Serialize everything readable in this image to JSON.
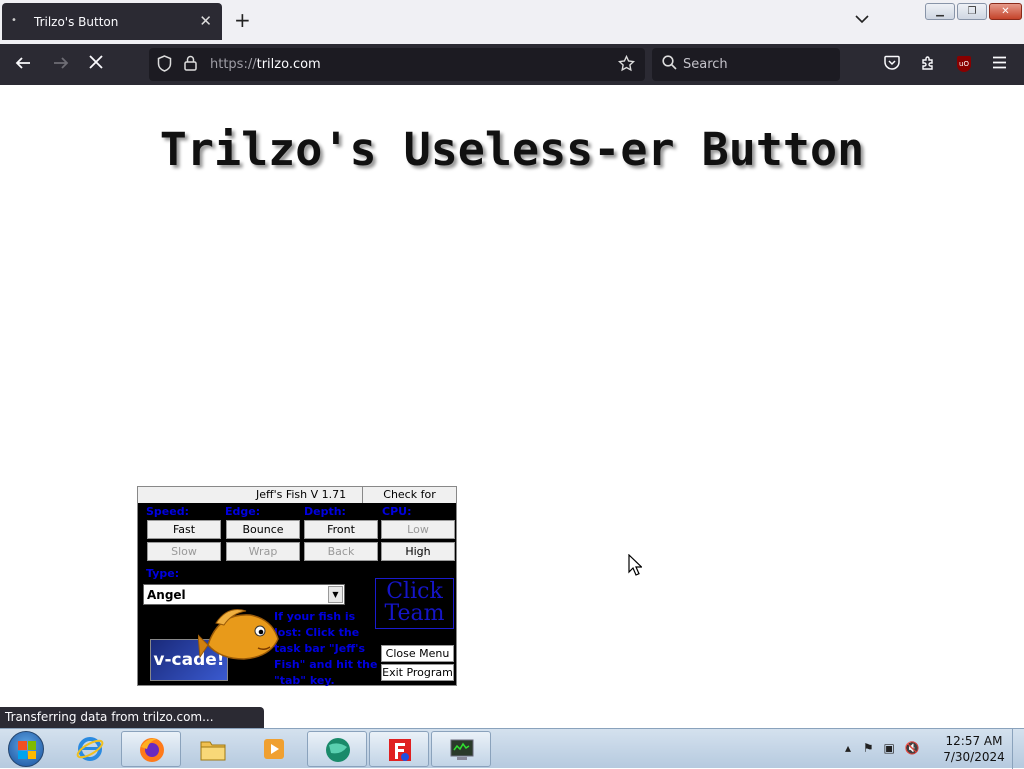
{
  "browser": {
    "tab_title": "Trilzo's Button",
    "tab_dot": "•",
    "tab_close": "✕",
    "new_tab": "+",
    "tab_list": "⌄",
    "url_protocol": "https://",
    "url_host": "trilzo.com",
    "search_placeholder": "Search",
    "status_text": "Transferring data from trilzo.com..."
  },
  "page": {
    "heading": "Trilzo's Useless-er Button"
  },
  "fish_widget": {
    "title": "Jeff's Fish V 1.71",
    "check_update": "Check for update",
    "labels": {
      "speed": "Speed:",
      "edge": "Edge:",
      "depth": "Depth:",
      "cpu": "CPU:",
      "type": "Type:"
    },
    "buttons": {
      "fast": "Fast",
      "slow": "Slow",
      "bounce": "Bounce",
      "wrap": "Wrap",
      "front": "Front",
      "back": "Back",
      "low": "Low",
      "high": "High"
    },
    "type_value": "Angel",
    "clickteam_line1": "Click",
    "clickteam_line2": "Team",
    "info_text": "If your fish is lost: Click the task bar \"Jeff's Fish\" and hit the \"tab\" key.",
    "vcade": "v-cade!",
    "close_menu": "Close Menu",
    "exit_program": "Exit Program"
  },
  "taskbar": {
    "clock_time": "12:57 AM",
    "clock_date": "7/30/2024"
  },
  "colors": {
    "chrome_dark": "#2b2a33",
    "widget_label_blue": "#0000e0",
    "clickteam_blue": "#1515c8",
    "fish_orange": "#e89a1a"
  }
}
